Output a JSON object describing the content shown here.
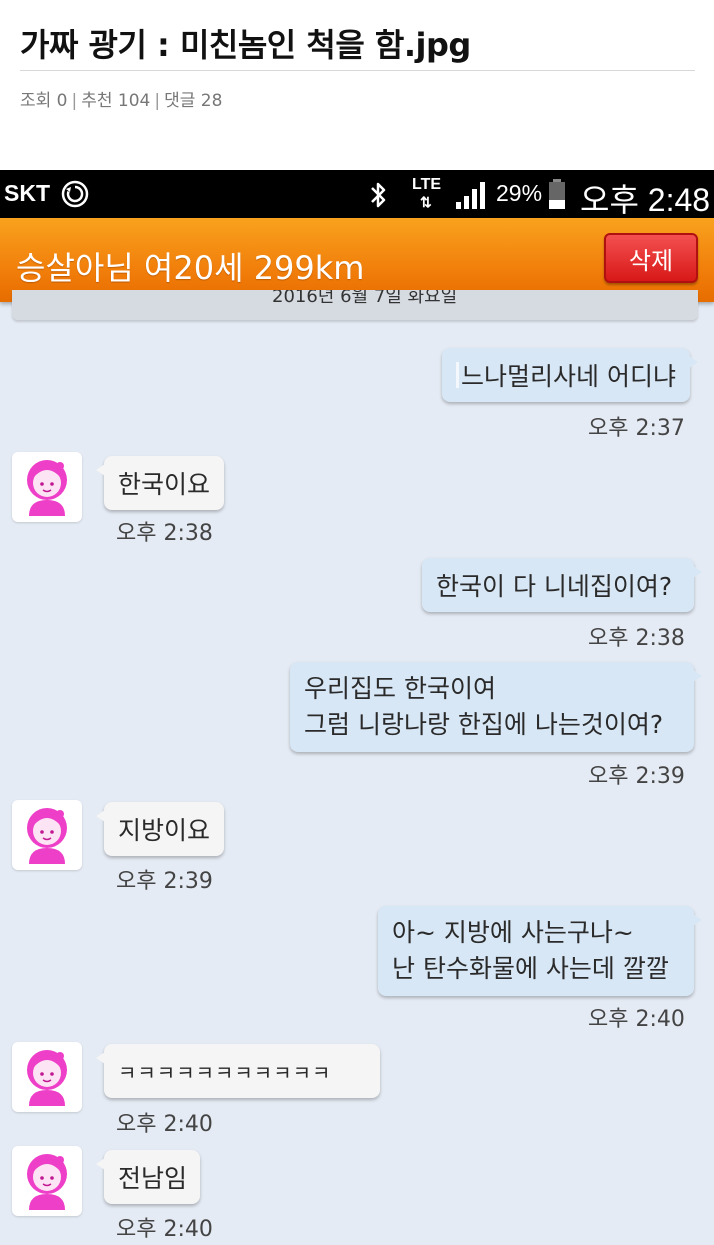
{
  "post": {
    "title": "가짜 광기 : 미친놈인 척을 함.jpg",
    "meta": {
      "views": "조회 0",
      "likes": "추천 104",
      "comments": "댓글 28"
    }
  },
  "status_bar": {
    "carrier": "SKT",
    "network": "LTE",
    "battery": "29%",
    "time": "오후 2:48",
    "icons": [
      "sync-icon",
      "bluetooth-icon",
      "lte-icon",
      "signal-icon",
      "battery-icon"
    ]
  },
  "chat": {
    "title": "승살아님 여20세 299km",
    "delete_label": "삭제",
    "date_divider": "2016년 6월 7일 화요일",
    "messages": [
      {
        "side": "sent",
        "lines": [
          "느나멀리사네 어디냐"
        ],
        "time": "오후 2:37"
      },
      {
        "side": "recv",
        "lines": [
          "한국이요"
        ],
        "time": "오후 2:38"
      },
      {
        "side": "sent",
        "lines": [
          "한국이 다 니네집이여?"
        ],
        "time": "오후 2:38"
      },
      {
        "side": "sent",
        "lines": [
          "우리집도 한국이여",
          "그럼 니랑나랑 한집에 나는것이여?"
        ],
        "time": "오후 2:39"
      },
      {
        "side": "recv",
        "lines": [
          "지방이요"
        ],
        "time": "오후 2:39"
      },
      {
        "side": "sent",
        "lines": [
          "아~ 지방에 사는구나~",
          "난 탄수화물에 사는데 깔깔"
        ],
        "time": "오후 2:40"
      },
      {
        "side": "recv",
        "lines": [
          "ㅋㅋㅋㅋㅋㅋㅋㅋㅋㅋㅋ"
        ],
        "time": "오후 2:40"
      },
      {
        "side": "recv",
        "lines": [
          "전남임"
        ],
        "time": "오후 2:40"
      }
    ]
  },
  "colors": {
    "header_orange": "#f28a10",
    "delete_red": "#e02828",
    "chat_background": "#e5ebf4",
    "sent_bubble": "#d8e7f5",
    "recv_bubble": "#f5f5f5",
    "avatar_pink": "#ee3fc8"
  }
}
